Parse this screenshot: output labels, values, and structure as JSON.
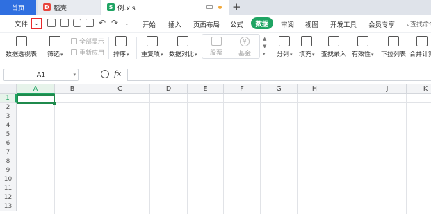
{
  "tabs": {
    "home": "首页",
    "doc1": "稻壳",
    "doc2": "例.xls",
    "new_tab": "+"
  },
  "menu": {
    "file": "文件",
    "items": [
      "开始",
      "插入",
      "页面布局",
      "公式",
      "数据",
      "审阅",
      "视图",
      "开发工具",
      "会员专享"
    ],
    "active": "数据",
    "search": "查找命令"
  },
  "ribbon": {
    "pivot": "数据透视表",
    "filter": "筛选",
    "show_all": "全部显示",
    "reapply": "重新应用",
    "sort": "排序",
    "duplicates": "重复项",
    "compare": "数据对比",
    "stock": "股票",
    "fund": "基金",
    "split": "分列",
    "fill": "填充",
    "lookup": "查找录入",
    "validity": "有效性",
    "dropdown": "下拉列表",
    "consolidate": "合并计算"
  },
  "formula_bar": {
    "name_box": "A1",
    "fx": "fx",
    "formula": ""
  },
  "grid": {
    "columns": [
      "A",
      "B",
      "C",
      "D",
      "E",
      "F",
      "G",
      "H",
      "I",
      "J",
      "K"
    ],
    "rows": [
      "1",
      "2",
      "3",
      "4",
      "5",
      "6",
      "7",
      "8",
      "9",
      "10",
      "11",
      "12",
      "13"
    ],
    "active_cell": "A1"
  },
  "colors": {
    "accent": "#1fa463",
    "home_tab": "#2f6fe0",
    "highlight_box": "#e8282b"
  }
}
